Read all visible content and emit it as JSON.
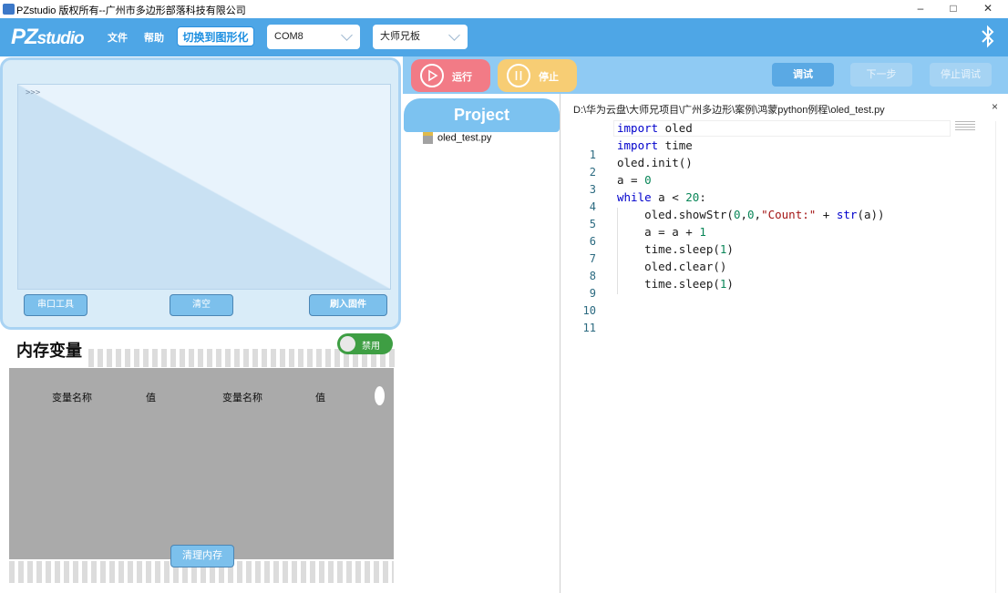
{
  "window": {
    "title": "PZstudio 版权所有--广州市多边形部落科技有限公司",
    "minimize": "–",
    "maximize": "□",
    "close": "✕"
  },
  "menubar": {
    "logo_main": "PZ",
    "logo_sub": "studio",
    "file_menu": "文件",
    "help_menu": "帮助",
    "switch_label": "切换到图形化",
    "port_value": "COM8",
    "board_value": "大师兄板",
    "bluetooth_glyph": "ᛒ"
  },
  "console": {
    "prompt": ">>>",
    "serial_tool": "串口工具",
    "clear": "清空",
    "flash_firmware": "刷入固件"
  },
  "memory": {
    "title": "内存变量",
    "toggle_label": "禁用",
    "col_name_1": "变量名称",
    "col_value_1": "值",
    "col_name_2": "变量名称",
    "col_value_2": "值",
    "clear_memory": "清理内存"
  },
  "toolbar": {
    "run": "运行",
    "stop": "停止",
    "debug": "调试",
    "next_step": "下一步",
    "stop_debug": "停止调试"
  },
  "project": {
    "header": "Project",
    "files": [
      "oled_test.py"
    ]
  },
  "editor": {
    "path": "D:\\华为云盘\\大师兄项目\\广州多边形\\案例\\鸿蒙python例程\\oled_test.py",
    "close": "×",
    "lines": [
      "import oled",
      "import time",
      "oled.init()",
      "a = 0",
      "while a < 20:",
      "    oled.showStr(0,0,\"Count:\" + str(a))",
      "    a = a + 1",
      "    time.sleep(1)",
      "    oled.clear()",
      "    time.sleep(1)",
      ""
    ]
  },
  "colors": {
    "accent": "#4ea6e6",
    "run": "#f27b86",
    "stop": "#f7cd74",
    "toggle": "#3e9e43"
  }
}
